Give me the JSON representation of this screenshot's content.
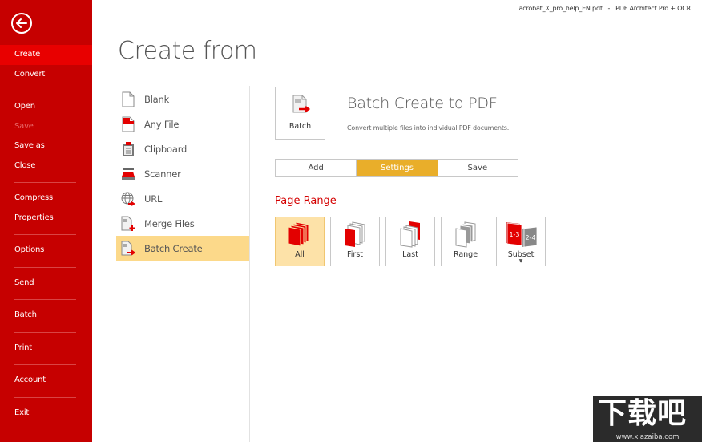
{
  "titlebar": {
    "document": "acrobat_X_pro_help_EN.pdf",
    "separator": "-",
    "app": "PDF Architect Pro + OCR"
  },
  "sidebar": {
    "back_icon": "back-arrow-circle-icon",
    "items": [
      {
        "label": "Create",
        "state": "active"
      },
      {
        "label": "Convert",
        "state": "normal"
      },
      {
        "label": "Open",
        "state": "normal"
      },
      {
        "label": "Save",
        "state": "disabled"
      },
      {
        "label": "Save as",
        "state": "normal"
      },
      {
        "label": "Close",
        "state": "normal"
      },
      {
        "label": "Compress",
        "state": "normal"
      },
      {
        "label": "Properties",
        "state": "normal"
      },
      {
        "label": "Options",
        "state": "normal"
      },
      {
        "label": "Send",
        "state": "normal"
      },
      {
        "label": "Batch",
        "state": "normal"
      },
      {
        "label": "Print",
        "state": "normal"
      },
      {
        "label": "Account",
        "state": "normal"
      },
      {
        "label": "Exit",
        "state": "normal"
      }
    ]
  },
  "page_title": "Create from",
  "sources": [
    {
      "label": "Blank",
      "icon": "blank-page-icon"
    },
    {
      "label": "Any File",
      "icon": "any-file-icon"
    },
    {
      "label": "Clipboard",
      "icon": "clipboard-icon"
    },
    {
      "label": "Scanner",
      "icon": "scanner-icon"
    },
    {
      "label": "URL",
      "icon": "url-globe-icon"
    },
    {
      "label": "Merge Files",
      "icon": "merge-files-icon"
    },
    {
      "label": "Batch Create",
      "icon": "batch-create-icon",
      "selected": true
    }
  ],
  "panel": {
    "tile_label": "Batch",
    "title": "Batch Create to PDF",
    "description": "Convert multiple files into individual PDF documents.",
    "tabs": [
      {
        "label": "Add",
        "active": false
      },
      {
        "label": "Settings",
        "active": true
      },
      {
        "label": "Save",
        "active": false
      }
    ],
    "section_heading": "Page Range",
    "range_options": [
      {
        "label": "All",
        "selected": true
      },
      {
        "label": "First",
        "selected": false
      },
      {
        "label": "Last",
        "selected": false
      },
      {
        "label": "Range",
        "selected": false
      },
      {
        "label": "Subset",
        "selected": false,
        "has_dropdown": true,
        "badges": [
          "1-3",
          "2-4"
        ]
      }
    ]
  },
  "colors": {
    "sidebar": "#c60000",
    "sidebar_active": "#e80000",
    "accent_red": "#d40000",
    "selected_bg": "#fcd98a",
    "tab_active": "#e9ae2a"
  },
  "watermark": {
    "logo": "下载吧",
    "url": "www.xiazaiba.com"
  }
}
